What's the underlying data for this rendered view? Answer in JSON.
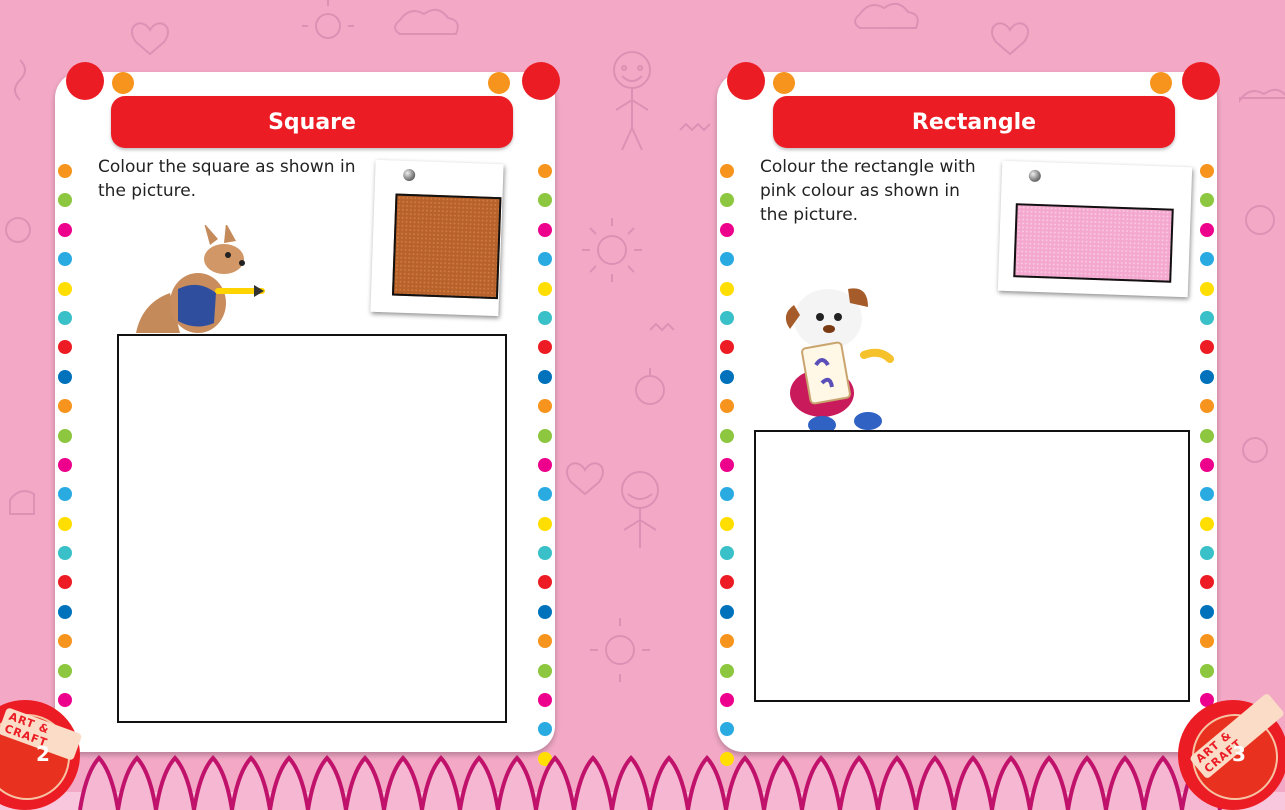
{
  "colors": {
    "background": "#f3a9c6",
    "title_bar": "#ec1c24",
    "dot_sequence": [
      "#f7941d",
      "#8dc63f",
      "#ec008c",
      "#29abe2",
      "#ffde00",
      "#39c0c8",
      "#ed1c24",
      "#0072bc"
    ],
    "square_swatch": "#b8622b",
    "rectangle_swatch": "#f4a8cf"
  },
  "left_page": {
    "title": "Square",
    "instruction_line1": "Colour the square as shown in",
    "instruction_line2": "the picture.",
    "mascot": "kangaroo-painting-icon",
    "badge_text": "ART & CRAFT",
    "page_number": "2"
  },
  "right_page": {
    "title": "Rectangle",
    "instruction_line1": "Colour the rectangle with",
    "instruction_line2": "pink colour as shown in",
    "instruction_line3": "the picture.",
    "mascot": "puppy-painting-icon",
    "badge_text": "ART & CRAFT",
    "page_number": "3"
  }
}
